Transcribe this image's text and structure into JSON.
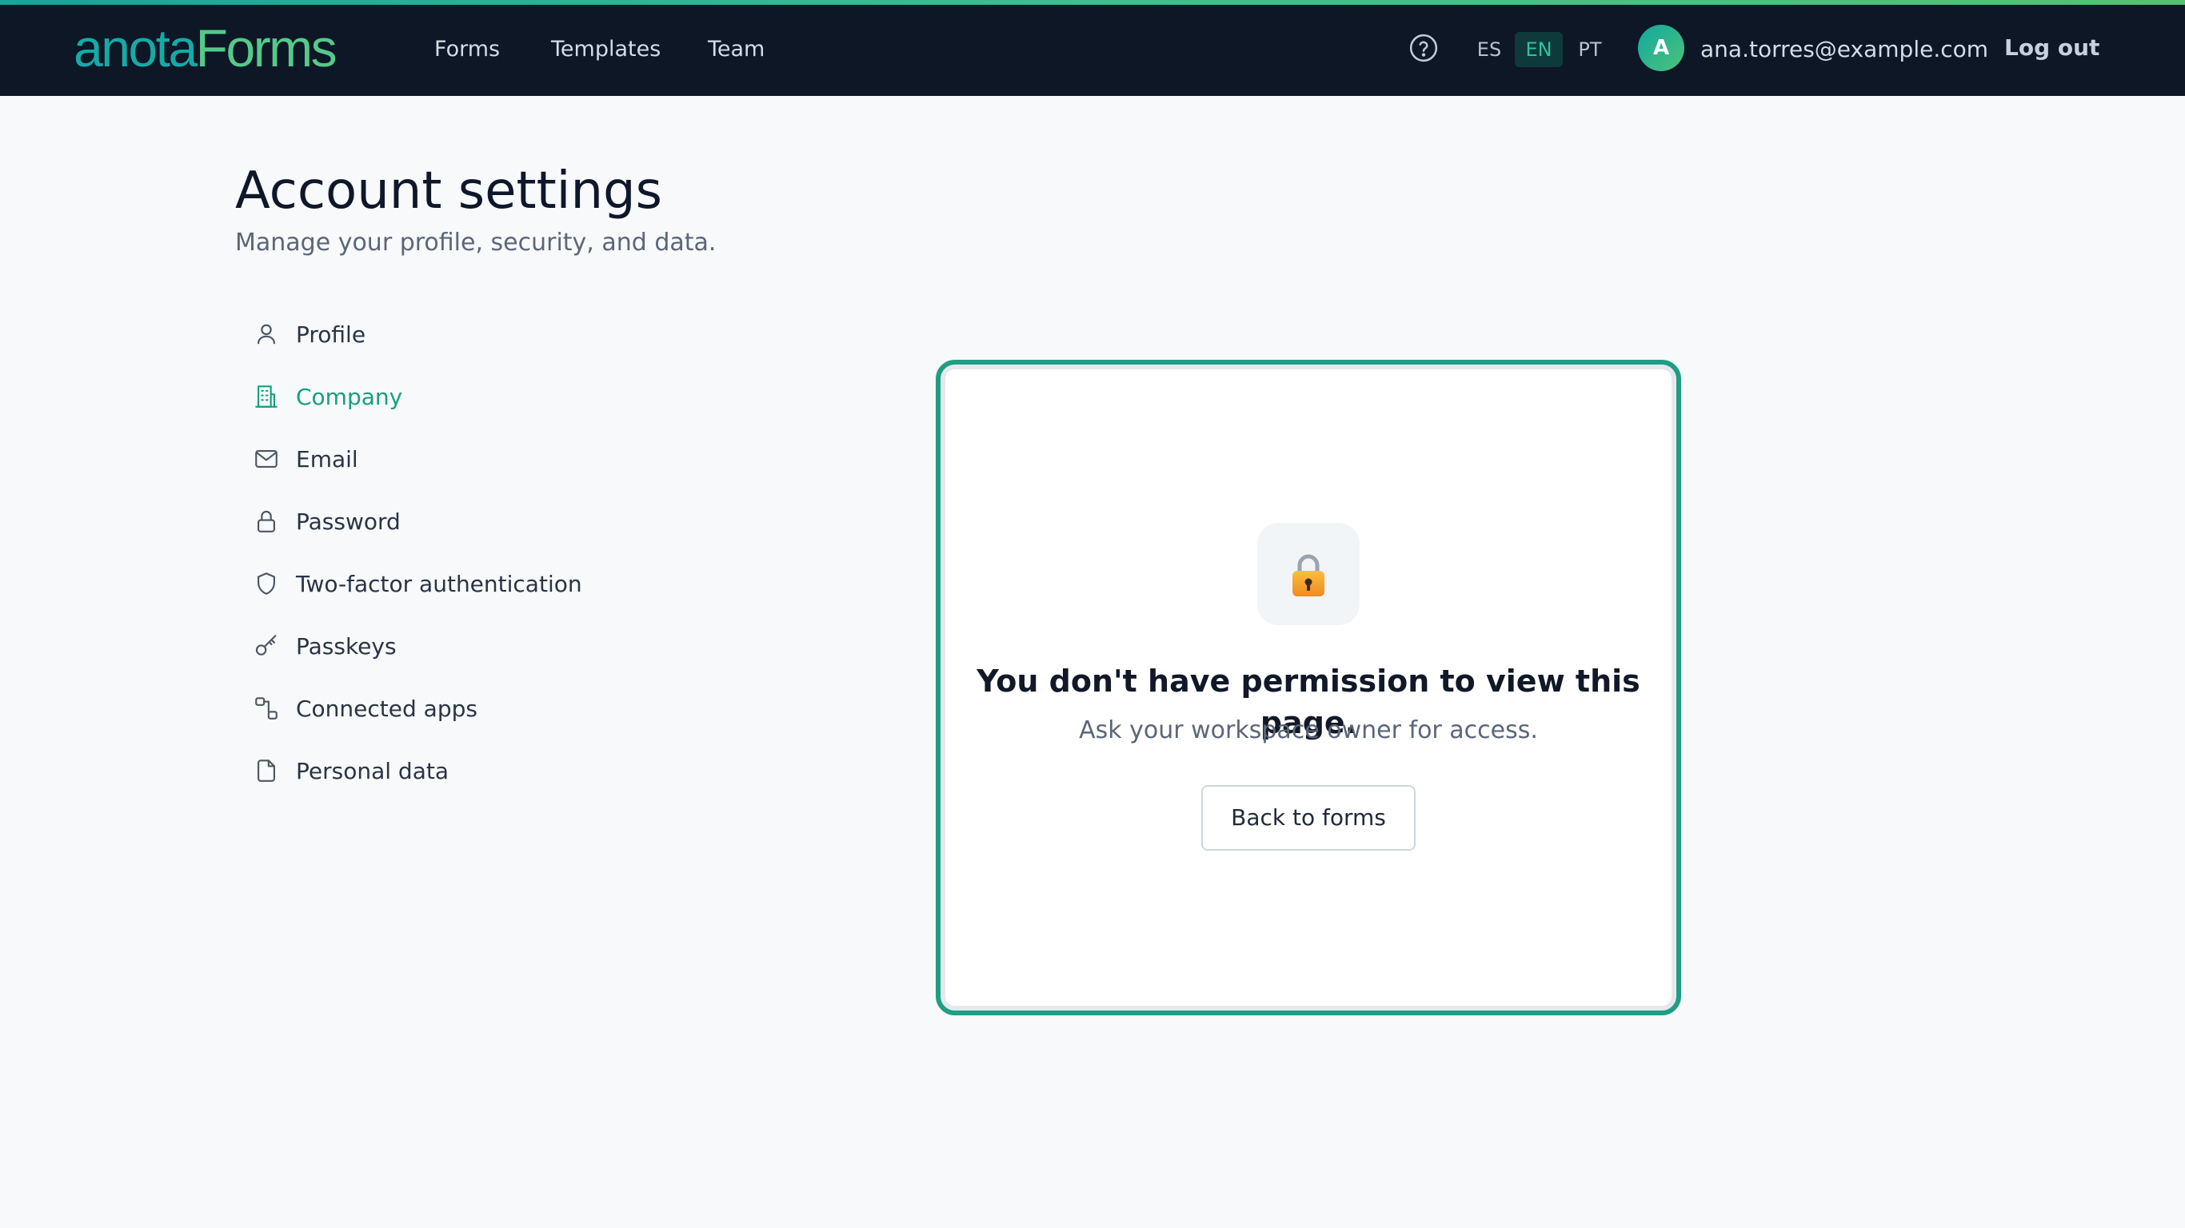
{
  "app": {
    "logo_part1": "anota",
    "logo_part2": "Forms"
  },
  "nav": {
    "links": [
      {
        "label": "Forms"
      },
      {
        "label": "Templates"
      },
      {
        "label": "Team"
      }
    ],
    "languages": [
      {
        "code": "ES",
        "active": false
      },
      {
        "code": "EN",
        "active": true
      },
      {
        "code": "PT",
        "active": false
      }
    ],
    "help_icon": "help-circle-icon",
    "user": {
      "avatar_initial": "A",
      "email": "ana.torres@example.com"
    },
    "logout_label": "Log out"
  },
  "page": {
    "title": "Account settings",
    "subtitle": "Manage your profile, security, and data."
  },
  "sidebar": {
    "active_item": "Company",
    "items": [
      {
        "label": "Profile",
        "icon": "user-icon"
      },
      {
        "label": "Company",
        "icon": "building-icon"
      },
      {
        "label": "Email",
        "icon": "mail-icon"
      },
      {
        "label": "Password",
        "icon": "lock-icon"
      },
      {
        "label": "Two-factor authentication",
        "icon": "shield-icon"
      },
      {
        "label": "Passkeys",
        "icon": "key-icon"
      },
      {
        "label": "Connected apps",
        "icon": "link-icon"
      },
      {
        "label": "Personal data",
        "icon": "file-icon"
      }
    ]
  },
  "permission": {
    "icon": "lock-icon",
    "title": "You don't have permission to view this page.",
    "message": "Ask your workspace owner for access.",
    "back_label": "Back to forms"
  },
  "colors": {
    "topbar_bg": "#0d1726",
    "accent": "#16a07e",
    "card_border": "#1f9e84",
    "page_bg": "#f7f9fb"
  }
}
